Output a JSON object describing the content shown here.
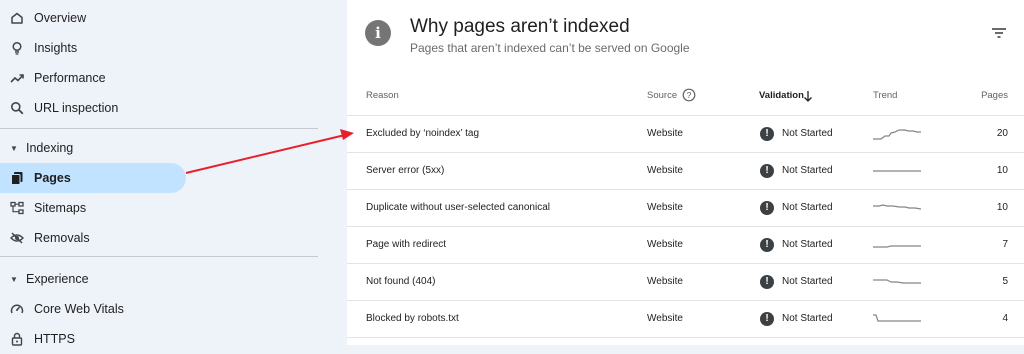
{
  "sidebar": {
    "items_top": [
      {
        "label": "Overview",
        "icon": "home-icon"
      },
      {
        "label": "Insights",
        "icon": "lightbulb-icon"
      },
      {
        "label": "Performance",
        "icon": "trending-up-icon"
      },
      {
        "label": "URL inspection",
        "icon": "search-icon"
      }
    ],
    "indexing_section": "Indexing",
    "indexing_items": [
      {
        "label": "Pages",
        "icon": "pages-icon"
      },
      {
        "label": "Sitemaps",
        "icon": "sitemap-icon"
      },
      {
        "label": "Removals",
        "icon": "eye-off-icon"
      }
    ],
    "experience_section": "Experience",
    "experience_items": [
      {
        "label": "Core Web Vitals",
        "icon": "speedometer-icon"
      },
      {
        "label": "HTTPS",
        "icon": "lock-icon"
      }
    ]
  },
  "card": {
    "title": "Why pages aren’t indexed",
    "subtitle": "Pages that aren’t indexed can’t be served on Google",
    "info_glyph": "i",
    "columns": {
      "reason": "Reason",
      "source": "Source",
      "validation": "Validation",
      "trend": "Trend",
      "pages": "Pages"
    },
    "rows": [
      {
        "reason": "Excluded by ‘noindex’ tag",
        "source": "Website",
        "validation": "Not Started",
        "pages": "20"
      },
      {
        "reason": "Server error (5xx)",
        "source": "Website",
        "validation": "Not Started",
        "pages": "10"
      },
      {
        "reason": "Duplicate without user-selected canonical",
        "source": "Website",
        "validation": "Not Started",
        "pages": "10"
      },
      {
        "reason": "Page with redirect",
        "source": "Website",
        "validation": "Not Started",
        "pages": "7"
      },
      {
        "reason": "Not found (404)",
        "source": "Website",
        "validation": "Not Started",
        "pages": "5"
      },
      {
        "reason": "Blocked by robots.txt",
        "source": "Website",
        "validation": "Not Started",
        "pages": "4"
      }
    ],
    "validation_glyph": "!"
  },
  "colors": {
    "active_nav": "#c2e3ff",
    "sidebar_bg": "#eef2f9",
    "annotation_arrow": "#e8202a"
  }
}
